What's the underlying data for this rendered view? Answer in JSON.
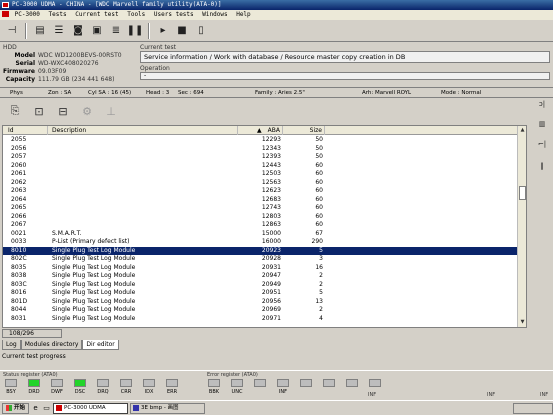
{
  "window": {
    "title": "PC-3000 UDMA - CHINA - [WDC Marvell family utility(ATA-0)]"
  },
  "menu": {
    "items": [
      "PC-3000",
      "Tests",
      "Current test",
      "Tools",
      "Users tests",
      "Windows",
      "Help"
    ]
  },
  "hdd": {
    "label": "HDD",
    "fields": [
      {
        "key": "Model",
        "value": "WDC WD1200BEVS-00RST0"
      },
      {
        "key": "Serial",
        "value": "WD-WXC408020276"
      },
      {
        "key": "Firmware",
        "value": "09.03F09"
      },
      {
        "key": "Capacity",
        "value": "111.79 GB (234 441 648)"
      }
    ]
  },
  "current_test": {
    "label": "Current test",
    "value": "Service information / Work with database / Resource master copy creation in DB",
    "operation_label": "Operation",
    "operation_value": "-"
  },
  "status_line": {
    "phys": "Phys",
    "zone": "Zon : SA",
    "cyl": "Cyl SA : 16 (45)",
    "head": "Head : 3",
    "sec": "Sec : 694",
    "family": "Family : Aries 2.5\"",
    "arh": "Arh: Marvell ROYL",
    "mode": "Mode : Normal"
  },
  "grid": {
    "columns": {
      "id": "Id",
      "description": "Description",
      "aba": "ABA",
      "size": "Size"
    },
    "rows": [
      {
        "id": "2055",
        "description": "",
        "aba": "12293",
        "size": "50"
      },
      {
        "id": "2056",
        "description": "",
        "aba": "12343",
        "size": "50"
      },
      {
        "id": "2057",
        "description": "",
        "aba": "12393",
        "size": "50"
      },
      {
        "id": "2060",
        "description": "",
        "aba": "12443",
        "size": "60"
      },
      {
        "id": "2061",
        "description": "",
        "aba": "12503",
        "size": "60"
      },
      {
        "id": "2062",
        "description": "",
        "aba": "12563",
        "size": "60"
      },
      {
        "id": "2063",
        "description": "",
        "aba": "12623",
        "size": "60"
      },
      {
        "id": "2064",
        "description": "",
        "aba": "12683",
        "size": "60"
      },
      {
        "id": "2065",
        "description": "",
        "aba": "12743",
        "size": "60"
      },
      {
        "id": "2066",
        "description": "",
        "aba": "12803",
        "size": "60"
      },
      {
        "id": "2067",
        "description": "",
        "aba": "12863",
        "size": "60"
      },
      {
        "id": "0021",
        "description": "S.M.A.R.T.",
        "aba": "15000",
        "size": "67"
      },
      {
        "id": "0033",
        "description": "P-List (Primary defect list)",
        "aba": "16000",
        "size": "290"
      },
      {
        "id": "8010",
        "description": "Single Plug Test Log Module",
        "aba": "20923",
        "size": "5"
      },
      {
        "id": "802C",
        "description": "Single Plug Test Log Module",
        "aba": "20928",
        "size": "3"
      },
      {
        "id": "8035",
        "description": "Single Plug Test Log Module",
        "aba": "20931",
        "size": "16"
      },
      {
        "id": "8038",
        "description": "Single Plug Test Log Module",
        "aba": "20947",
        "size": "2"
      },
      {
        "id": "803C",
        "description": "Single Plug Test Log Module",
        "aba": "20949",
        "size": "2"
      },
      {
        "id": "8016",
        "description": "Single Plug Test Log Module",
        "aba": "20951",
        "size": "5"
      },
      {
        "id": "801D",
        "description": "Single Plug Test Log Module",
        "aba": "20956",
        "size": "13"
      },
      {
        "id": "8044",
        "description": "Single Plug Test Log Module",
        "aba": "20969",
        "size": "2"
      },
      {
        "id": "8031",
        "description": "Single Plug Test Log Module",
        "aba": "20971",
        "size": "4"
      }
    ],
    "selected_index": 13
  },
  "counter": "108/296",
  "tabs": [
    "Log",
    "Modules directory",
    "Dir editor"
  ],
  "progress_label": "Current test progress",
  "status_register": {
    "label": "Status register (ATA0)",
    "leds": [
      {
        "name": "BSY",
        "on": false
      },
      {
        "name": "DRD",
        "on": true
      },
      {
        "name": "DWF",
        "on": false
      },
      {
        "name": "DSC",
        "on": true
      },
      {
        "name": "DRQ",
        "on": false
      },
      {
        "name": "CRR",
        "on": false
      },
      {
        "name": "IDX",
        "on": false
      },
      {
        "name": "ERR",
        "on": false
      }
    ]
  },
  "error_register": {
    "label": "Error register (ATA0)",
    "leds": [
      {
        "name": "BBK",
        "on": false
      },
      {
        "name": "UNC",
        "on": false
      },
      {
        "name": "",
        "on": false
      },
      {
        "name": "INF",
        "on": false
      },
      {
        "name": "",
        "on": false
      },
      {
        "name": "",
        "on": false
      },
      {
        "name": "",
        "on": false
      },
      {
        "name": "",
        "on": false
      }
    ]
  },
  "inf_labels": [
    "INF",
    "INF",
    "INF"
  ],
  "taskbar": {
    "start": "开始",
    "tasks": [
      {
        "label": "PC-3000 UDMA",
        "active": true
      },
      {
        "label": "3E bmp - 画图",
        "active": false
      }
    ]
  },
  "colors": {
    "led_on": "#22d42a",
    "selection": "#0a246a",
    "titlebar": "#0a246a"
  },
  "icons": {
    "toolbar": [
      "back-icon",
      "database-icon",
      "list-icon",
      "disk-icon",
      "chip-icon",
      "stack-icon",
      "pause-icon",
      "play-icon",
      "stop-icon",
      "next-icon"
    ],
    "right_panel": [
      "power-icon",
      "key-icon",
      "connector-icon",
      "pause-icon"
    ]
  }
}
